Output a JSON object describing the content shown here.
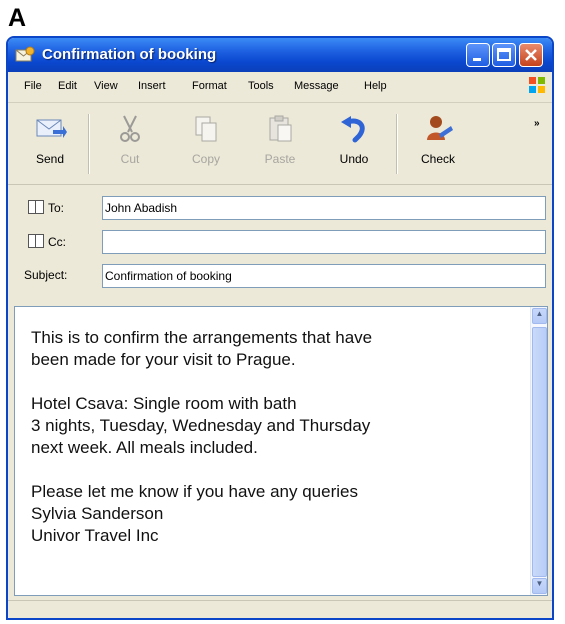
{
  "figure_label": "A",
  "window": {
    "title": "Confirmation of booking"
  },
  "menu": [
    "File",
    "Edit",
    "View",
    "Insert",
    "Format",
    "Tools",
    "Message",
    "Help"
  ],
  "toolbar": {
    "send": "Send",
    "cut": "Cut",
    "copy": "Copy",
    "paste": "Paste",
    "undo": "Undo",
    "check": "Check"
  },
  "fields": {
    "to_label": "To:",
    "to_value": "John Abadish",
    "cc_label": "Cc:",
    "cc_value": "",
    "subject_label": "Subject:",
    "subject_value": "Confirmation of booking"
  },
  "message": {
    "p1": [
      "This is to confirm the arrangements that have",
      "been made for your visit to Prague."
    ],
    "p2": [
      "Hotel Csava: Single room with bath",
      "3 nights, Tuesday, Wednesday and Thursday",
      "next week.  All meals included."
    ],
    "p3": [
      "Please let me know if you have any queries",
      "Sylvia Sanderson",
      "Univor Travel Inc"
    ]
  },
  "colors": {
    "titlebar": "#0a48d0",
    "window_face": "#ece9d8"
  },
  "icons": [
    "envelope-icon",
    "send-icon",
    "cut-icon",
    "copy-icon",
    "paste-icon",
    "undo-icon",
    "check-icon",
    "windows-logo-icon",
    "address-book-icon"
  ]
}
